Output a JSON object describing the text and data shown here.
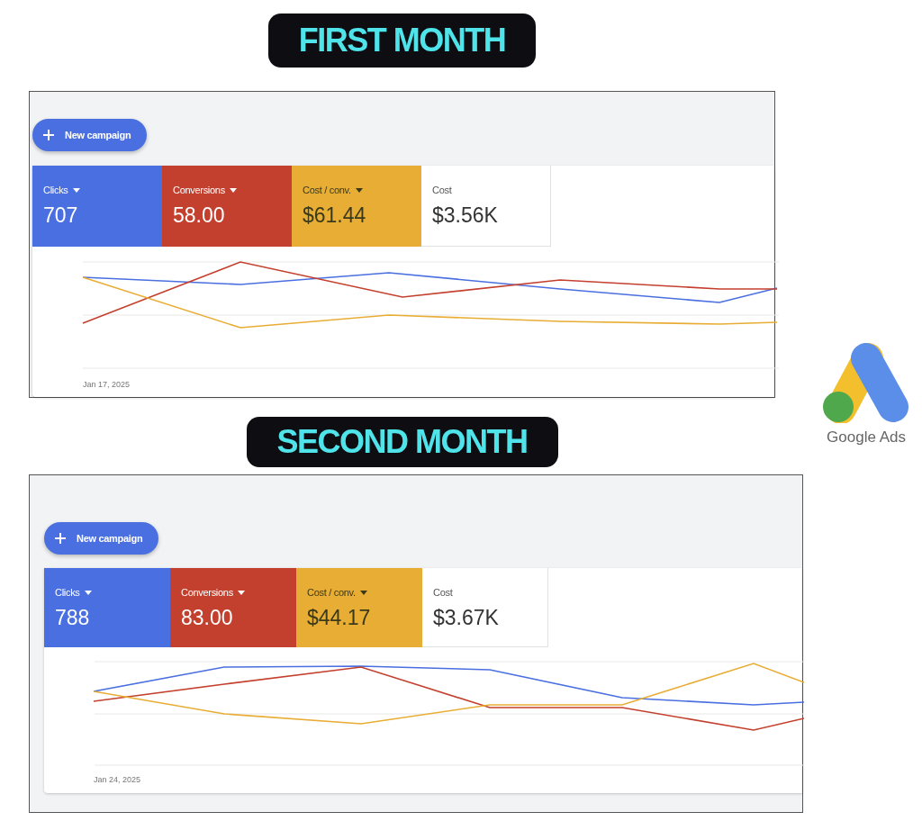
{
  "panels": [
    {
      "title": "FIRST MONTH",
      "button": "New campaign",
      "date_label": "Jan 17, 2025",
      "metrics": [
        {
          "label": "Clicks",
          "value": "707",
          "selected": true,
          "color": "#4a6fe0"
        },
        {
          "label": "Conversions",
          "value": "58.00",
          "selected": true,
          "color": "#c4402e"
        },
        {
          "label": "Cost / conv.",
          "value": "$61.44",
          "selected": true,
          "color": "#e8ad34"
        },
        {
          "label": "Cost",
          "value": "$3.56K",
          "selected": false
        }
      ]
    },
    {
      "title": "SECOND MONTH",
      "button": "New campaign",
      "date_label": "Jan 24, 2025",
      "metrics": [
        {
          "label": "Clicks",
          "value": "788",
          "selected": true,
          "color": "#4a6fe0"
        },
        {
          "label": "Conversions",
          "value": "83.00",
          "selected": true,
          "color": "#c4402e"
        },
        {
          "label": "Cost / conv.",
          "value": "$44.17",
          "selected": true,
          "color": "#e8ad34"
        },
        {
          "label": "Cost",
          "value": "$3.67K",
          "selected": false
        }
      ]
    }
  ],
  "logo": {
    "text": "Google Ads"
  }
}
